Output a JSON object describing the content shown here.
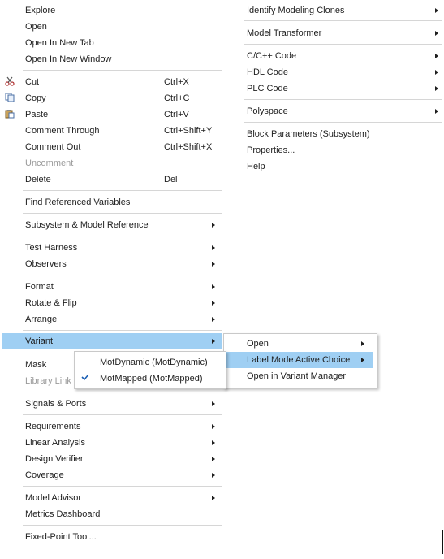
{
  "left_menu": {
    "explore": "Explore",
    "open": "Open",
    "open_new_tab": "Open In New Tab",
    "open_new_window": "Open In New Window",
    "cut": "Cut",
    "cut_key": "Ctrl+X",
    "copy": "Copy",
    "copy_key": "Ctrl+C",
    "paste": "Paste",
    "paste_key": "Ctrl+V",
    "comment_through": "Comment Through",
    "comment_through_key": "Ctrl+Shift+Y",
    "comment_out": "Comment Out",
    "comment_out_key": "Ctrl+Shift+X",
    "uncomment": "Uncomment",
    "delete": "Delete",
    "delete_key": "Del",
    "find_referenced_variables": "Find Referenced Variables",
    "subsystem_model_reference": "Subsystem & Model Reference",
    "test_harness": "Test Harness",
    "observers": "Observers",
    "format": "Format",
    "rotate_flip": "Rotate & Flip",
    "arrange": "Arrange",
    "variant": "Variant",
    "mask": "Mask",
    "library_link": "Library Link",
    "signals_ports": "Signals & Ports",
    "requirements": "Requirements",
    "linear_analysis": "Linear Analysis",
    "design_verifier": "Design Verifier",
    "coverage": "Coverage",
    "model_advisor": "Model Advisor",
    "metrics_dashboard": "Metrics Dashboard",
    "fixed_point_tool": "Fixed-Point Tool..."
  },
  "right_menu": {
    "identify_modeling_clones": "Identify Modeling Clones",
    "model_transformer": "Model Transformer",
    "c_cpp_code": "C/C++ Code",
    "hdl_code": "HDL Code",
    "plc_code": "PLC Code",
    "polyspace": "Polyspace",
    "block_parameters": "Block Parameters (Subsystem)",
    "properties": "Properties...",
    "help": "Help"
  },
  "variant_submenu": {
    "open": "Open",
    "label_mode_active_choice": "Label Mode Active Choice",
    "open_in_variant_manager": "Open in Variant Manager"
  },
  "label_mode_submenu": {
    "mot_dynamic": "MotDynamic (MotDynamic)",
    "mot_mapped": "MotMapped (MotMapped)",
    "checked_item": "MotMapped (MotMapped)"
  },
  "icons": {
    "cut": "scissors-icon",
    "copy": "copy-icon",
    "paste": "paste-icon",
    "submenu": "chevron-right-icon",
    "check": "checkmark-icon"
  },
  "colors": {
    "highlight": "#9fcff3",
    "separator": "#d6d6d6",
    "disabled_text": "#9a9a9a",
    "text": "#1e1e1e"
  }
}
